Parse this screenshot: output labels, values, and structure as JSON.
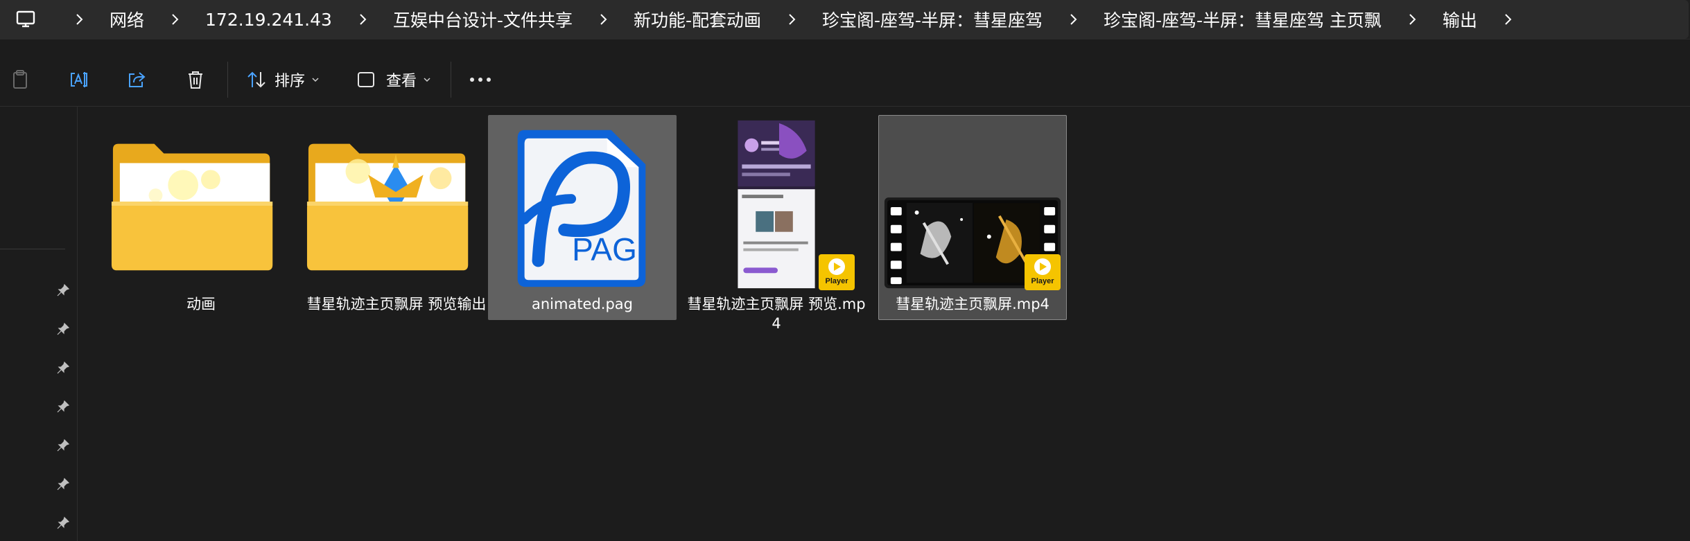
{
  "breadcrumb": [
    "网络",
    "172.19.241.43",
    "互娱中台设计-文件共享",
    "新功能-配套动画",
    "珍宝阁-座驾-半屏：彗星座驾",
    "珍宝阁-座驾-半屏：彗星座驾 主页飘",
    "输出"
  ],
  "toolbar": {
    "sort_label": "排序",
    "view_label": "查看",
    "icons": [
      "clipboard-icon",
      "rename-icon",
      "share-icon",
      "delete-icon",
      "more-icon"
    ]
  },
  "files": [
    {
      "name": "动画",
      "type": "folder",
      "selected": false
    },
    {
      "name": "彗星轨迹主页飘屏 预览输出",
      "type": "folder",
      "selected": false
    },
    {
      "name": "animated.pag",
      "type": "pag",
      "selected": true
    },
    {
      "name": "彗星轨迹主页飘屏 预览.mp4",
      "type": "video",
      "selected": false
    },
    {
      "name": "彗星轨迹主页飘屏.mp4",
      "type": "video",
      "selected": true
    }
  ],
  "pag_icon_text": "PAG",
  "player_badge_text": "Player",
  "colors": {
    "background": "#1c1c1c",
    "folder": "#f8c33c",
    "pag_blue": "#0d63d8",
    "badge": "#f5c400"
  }
}
